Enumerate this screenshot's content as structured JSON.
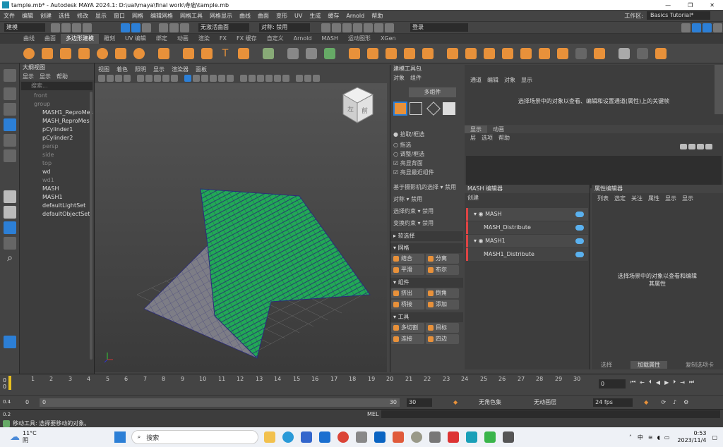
{
  "titlebar": {
    "title": "tample.mb* - Autodesk MAYA 2024.1: D:\\ual\\maya\\final work\\寺庙\\tample.mb"
  },
  "menubar": {
    "items": [
      "文件",
      "编辑",
      "创建",
      "选择",
      "修改",
      "显示",
      "窗口",
      "网格",
      "编辑网格",
      "网格工具",
      "网格显示",
      "曲线",
      "曲面",
      "变形",
      "UV",
      "生成",
      "缓存",
      "Arnold",
      "帮助"
    ],
    "workspace_label": "工作区:",
    "workspace_value": "Basics Tutorial*"
  },
  "statusline": {
    "mode": "建模",
    "live_surface": "无激活曲面",
    "symmetry": "对称: 禁用",
    "login": "登录"
  },
  "shelf_tabs": [
    "曲线",
    "曲面",
    "多边形建模",
    "雕刻",
    "UV 编辑",
    "绑定",
    "动画",
    "渲染",
    "FX",
    "FX 缓存",
    "自定义",
    "Arnold",
    "MASH",
    "运动图形",
    "XGen"
  ],
  "shelf_active": 2,
  "outliner": {
    "title": "大纲视图",
    "menu": [
      "显示",
      "显示",
      "帮助"
    ],
    "search_placeholder": "搜索...",
    "items": [
      {
        "label": "front",
        "dim": true
      },
      {
        "label": "group",
        "dim": true
      },
      {
        "label": "MASH1_ReproMes",
        "dim": false
      },
      {
        "label": "MASH_ReproMesh",
        "dim": false
      },
      {
        "label": "pCylinder1",
        "dim": false
      },
      {
        "label": "pCylinder2",
        "dim": false
      },
      {
        "label": "persp",
        "dim": true
      },
      {
        "label": "side",
        "dim": true
      },
      {
        "label": "top",
        "dim": true
      },
      {
        "label": "wd",
        "dim": false
      },
      {
        "label": "wd1",
        "dim": true
      },
      {
        "label": "MASH",
        "dim": false
      },
      {
        "label": "MASH1",
        "dim": false
      },
      {
        "label": "defaultLightSet",
        "dim": false
      },
      {
        "label": "defaultObjectSet",
        "dim": false
      }
    ]
  },
  "viewport": {
    "menu": [
      "视图",
      "着色",
      "照明",
      "显示",
      "渲染器",
      "面板"
    ],
    "viewcube_left": "左",
    "viewcube_front": "前"
  },
  "modeling_toolkit": {
    "title": "建模工具包",
    "menu": [
      "对象",
      "组件"
    ],
    "mode_button": "多组件",
    "radios": [
      "拾取/框选",
      "拖选",
      "调整/框选"
    ],
    "checks": [
      "亮显背面",
      "亮显最近组件"
    ],
    "camera_based": "基于摄影机的选择",
    "camera_based_val": "禁用",
    "symmetry_label": "对称",
    "symmetry_val": "禁用",
    "select_constraint": "选择约束",
    "select_constraint_val": "禁用",
    "transform_constraint": "变换约束",
    "transform_constraint_val": "禁用",
    "soft_select": "软选择",
    "sections": [
      {
        "title": "网格",
        "buttons": [
          "结合",
          "分离",
          "平滑",
          "布尔"
        ]
      },
      {
        "title": "组件",
        "buttons": [
          "挤出",
          "倒角",
          "桥接",
          "添加"
        ]
      },
      {
        "title": "工具",
        "buttons": [
          "多切割",
          "目标",
          "连接",
          "四边"
        ]
      }
    ]
  },
  "channel_box": {
    "menu": [
      "通道",
      "编辑",
      "对象",
      "显示"
    ],
    "message": "选择场景中的对象以查看、编辑和设置通道(属性)上的关键帧",
    "tabs": [
      "显示",
      "动画"
    ],
    "submenu": [
      "层",
      "选项",
      "帮助"
    ]
  },
  "mash_editor": {
    "title": "MASH 编辑器",
    "create": "创建",
    "rows": [
      {
        "label": "MASH",
        "child": false
      },
      {
        "label": "MASH_Distribute",
        "child": true
      },
      {
        "label": "MASH1",
        "child": false
      },
      {
        "label": "MASH1_Distribute",
        "child": true
      }
    ]
  },
  "attr_editor": {
    "title": "属性编辑器",
    "menu": [
      "列表",
      "选定",
      "关注",
      "属性",
      "显示",
      "显示"
    ],
    "message_line1": "选择场景中的对象以查看和编辑",
    "message_line2": "其属性",
    "buttons": [
      "选择",
      "加载属性",
      "复制选项卡"
    ]
  },
  "timeslider": {
    "ticks": [
      "1",
      "2",
      "3",
      "4",
      "5",
      "6",
      "7",
      "8",
      "9",
      "10",
      "11",
      "12",
      "13",
      "14",
      "15",
      "16",
      "17",
      "18",
      "19",
      "20",
      "21",
      "22",
      "23",
      "24",
      "25",
      "26",
      "27",
      "28",
      "29",
      "30"
    ],
    "current_frame": "0",
    "left_top": "0",
    "left_bottom": "0"
  },
  "range": {
    "start": "0",
    "start_inner": "0",
    "end_inner": "30",
    "end": "30",
    "char_set": "无角色集",
    "anim_layer": "无动画层",
    "fps": "24 fps",
    "small_top": "0.4",
    "small_bottom": "0.2"
  },
  "helpline": {
    "mel": "MEL",
    "message": "移动工具: 选择要移动的对象。"
  },
  "taskbar": {
    "weather_temp": "11°C",
    "weather_desc": "阴",
    "search": "搜索",
    "time": "0:53",
    "date": "2023/11/4",
    "lang": "中"
  },
  "colors": {
    "accent": "#5ab1ef",
    "orange": "#e8913a",
    "roof": "#1f9e52",
    "mash_red": "#d44"
  }
}
